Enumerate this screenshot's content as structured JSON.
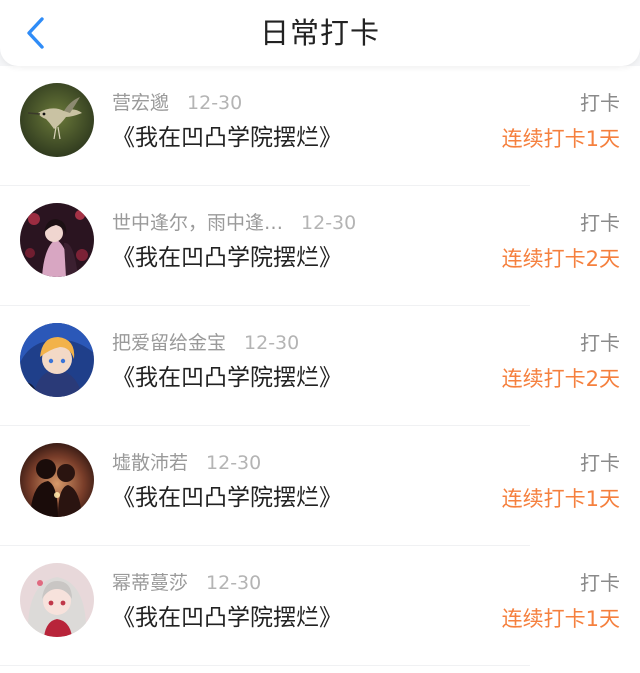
{
  "header": {
    "title": "日常打卡",
    "back_icon": "chevron-left-icon",
    "back_color": "#2f8cf7"
  },
  "colors": {
    "streak": "#f5803e",
    "name": "#9a9a9a",
    "text": "#222222"
  },
  "records": [
    {
      "name": "营宏邈",
      "date": "12-30",
      "book": "《我在凹凸学院摆烂》",
      "action": "打卡",
      "streak": "连续打卡1天",
      "avatar_icon": "hummingbird-avatar"
    },
    {
      "name": "世中逢尔，雨中逢…",
      "date": "12-30",
      "book": "《我在凹凸学院摆烂》",
      "action": "打卡",
      "streak": "连续打卡2天",
      "avatar_icon": "anime-couple-avatar"
    },
    {
      "name": "把爱留给金宝",
      "date": "12-30",
      "book": "《我在凹凸学院摆烂》",
      "action": "打卡",
      "streak": "连续打卡2天",
      "avatar_icon": "anime-boy-avatar"
    },
    {
      "name": "墟散沛若",
      "date": "12-30",
      "book": "《我在凹凸学院摆烂》",
      "action": "打卡",
      "streak": "连续打卡1天",
      "avatar_icon": "couple-silhouette-avatar"
    },
    {
      "name": "幂蒂蔓莎",
      "date": "12-30",
      "book": "《我在凹凸学院摆烂》",
      "action": "打卡",
      "streak": "连续打卡1天",
      "avatar_icon": "anime-girl-avatar"
    }
  ]
}
